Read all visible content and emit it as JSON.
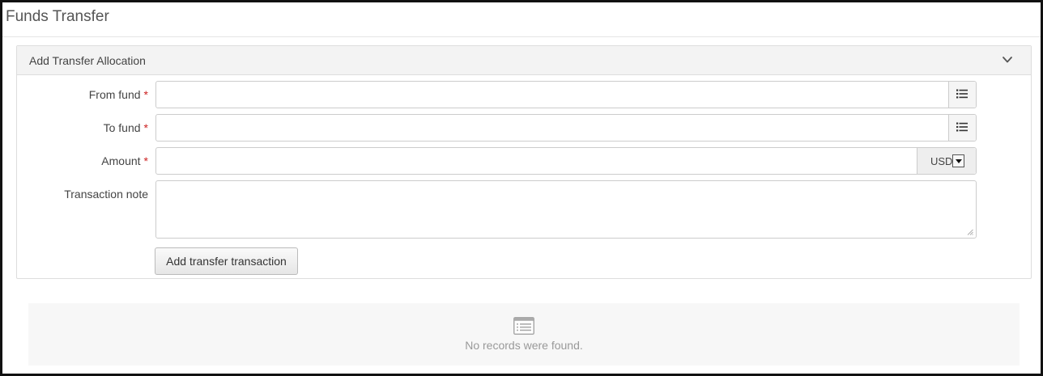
{
  "page": {
    "title": "Funds Transfer"
  },
  "panel": {
    "title": "Add Transfer Allocation",
    "collapse_icon": "chevron-down-icon"
  },
  "form": {
    "required_marker": "*",
    "from_fund": {
      "label": "From fund",
      "value": "",
      "picker_icon": "list-picker-icon"
    },
    "to_fund": {
      "label": "To fund",
      "value": "",
      "picker_icon": "list-picker-icon"
    },
    "amount": {
      "label": "Amount",
      "value": "",
      "currency": "USD"
    },
    "transaction_note": {
      "label": "Transaction note",
      "value": ""
    },
    "submit_label": "Add transfer transaction"
  },
  "results": {
    "empty_icon": "list-document-icon",
    "empty_message": "No records were found."
  },
  "colors": {
    "required": "#cc2222",
    "panel_heading": "#f3f3f3",
    "empty_state_bg": "#f7f7f7",
    "empty_text": "#999999"
  }
}
